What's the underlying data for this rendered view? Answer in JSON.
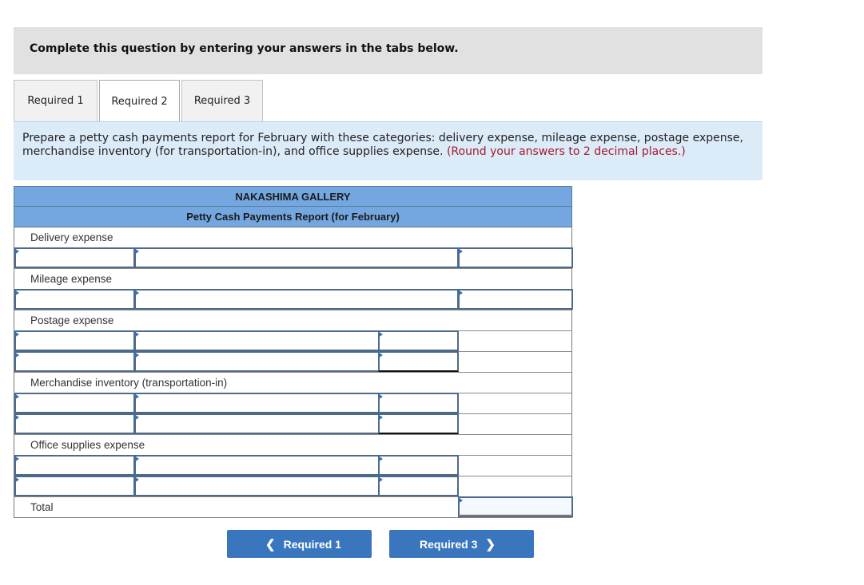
{
  "instruction": "Complete this question by entering your answers in the tabs below.",
  "tabs": [
    {
      "label": "Required 1",
      "active": false
    },
    {
      "label": "Required 2",
      "active": true
    },
    {
      "label": "Required 3",
      "active": false
    }
  ],
  "prompt": {
    "text": "Prepare a petty cash payments report for February with these categories: delivery expense, mileage expense, postage expense, merchandise inventory (for transportation-in), and office supplies expense.",
    "note": "(Round your answers to 2 decimal places.)"
  },
  "report": {
    "company": "NAKASHIMA GALLERY",
    "title": "Petty Cash Payments Report (for February)",
    "sections": [
      {
        "label": "Delivery expense"
      },
      {
        "label": "Mileage expense"
      },
      {
        "label": "Postage expense"
      },
      {
        "label": "Merchandise inventory (transportation-in)"
      },
      {
        "label": "Office supplies expense"
      }
    ],
    "total_label": "Total",
    "colors": {
      "header_bg": "#74a7e0",
      "input_border": "#4d6a8a",
      "button_bg": "#3a76bd",
      "note": "#a4192c"
    }
  },
  "nav": {
    "prev_label": "Required 1",
    "next_label": "Required 3",
    "prev_icon": "chevron-left-icon",
    "next_icon": "chevron-right-icon"
  }
}
